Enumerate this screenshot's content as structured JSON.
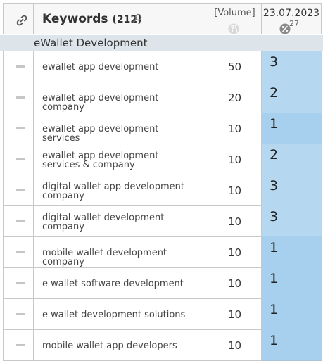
{
  "header": {
    "keywords_title": "Keywords",
    "keywords_count": "(212)",
    "volume_label": "[Volume]",
    "date_label": "23.07.2023",
    "percent_number": "27"
  },
  "icons": {
    "link": "link-icon",
    "search": "search-icon",
    "globe": "globe-icon",
    "percent": "percent-icon",
    "remove": "minus-icon"
  },
  "colors": {
    "rank_bg_light": "#b3d7ef",
    "rank_bg_medium": "#a5d1ee",
    "group_bg": "#dde4ea"
  },
  "group": {
    "label": "eWallet Development"
  },
  "rows": [
    {
      "keyword": "ewallet app development",
      "volume": "50",
      "rank": "3"
    },
    {
      "keyword": "ewallet app development company",
      "volume": "20",
      "rank": "2"
    },
    {
      "keyword": "ewallet app development services",
      "volume": "10",
      "rank": "1"
    },
    {
      "keyword": "ewallet app development services & company",
      "volume": "10",
      "rank": "2"
    },
    {
      "keyword": "digital wallet app development company",
      "volume": "10",
      "rank": "3"
    },
    {
      "keyword": "digital wallet development company",
      "volume": "10",
      "rank": "3"
    },
    {
      "keyword": "mobile wallet development company",
      "volume": "10",
      "rank": "1"
    },
    {
      "keyword": "e wallet software development",
      "volume": "10",
      "rank": "1"
    },
    {
      "keyword": "e wallet development solutions",
      "volume": "10",
      "rank": "1"
    },
    {
      "keyword": "mobile wallet app developers",
      "volume": "10",
      "rank": "1"
    }
  ]
}
